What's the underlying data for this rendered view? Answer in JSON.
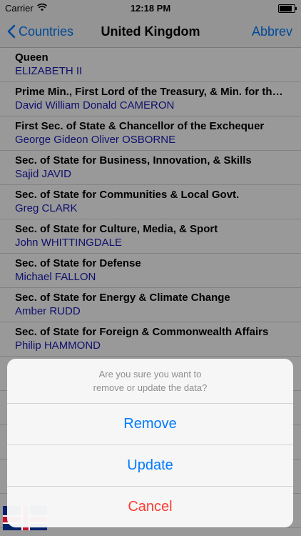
{
  "status": {
    "carrier": "Carrier",
    "time": "12:18 PM",
    "battery": 0.9
  },
  "nav": {
    "back_label": "Countries",
    "title": "United Kingdom",
    "right_label": "Abbrev"
  },
  "rows": [
    {
      "title": "Queen",
      "name": "ELIZABETH II"
    },
    {
      "title": "Prime Min., First Lord of the Treasury, & Min. for the C...",
      "name": "David William Donald CAMERON"
    },
    {
      "title": "First Sec. of State & Chancellor of the Exchequer",
      "name": "George Gideon Oliver OSBORNE"
    },
    {
      "title": "Sec. of State for Business, Innovation, & Skills",
      "name": "Sajid JAVID"
    },
    {
      "title": "Sec. of State for Communities & Local Govt.",
      "name": "Greg CLARK"
    },
    {
      "title": "Sec. of State for Culture, Media, & Sport",
      "name": "John WHITTINGDALE"
    },
    {
      "title": "Sec. of State for Defense",
      "name": "Michael FALLON"
    },
    {
      "title": "Sec. of State for Energy & Climate Change",
      "name": "Amber RUDD"
    },
    {
      "title": "Sec. of State for Foreign & Commonwealth Affairs",
      "name": "Philip HAMMOND"
    },
    {
      "title": "",
      "name": ""
    },
    {
      "title": "",
      "name": ""
    },
    {
      "title": "",
      "name": ""
    },
    {
      "title": "",
      "name": ""
    },
    {
      "title": "",
      "name": ""
    }
  ],
  "sheet": {
    "message": "Are you sure you want to\nremove or update the data?",
    "remove_label": "Remove",
    "update_label": "Update",
    "cancel_label": "Cancel"
  },
  "colors": {
    "accent": "#007aff",
    "destructive": "#ff3b30",
    "name_text": "#1a1ab8"
  }
}
